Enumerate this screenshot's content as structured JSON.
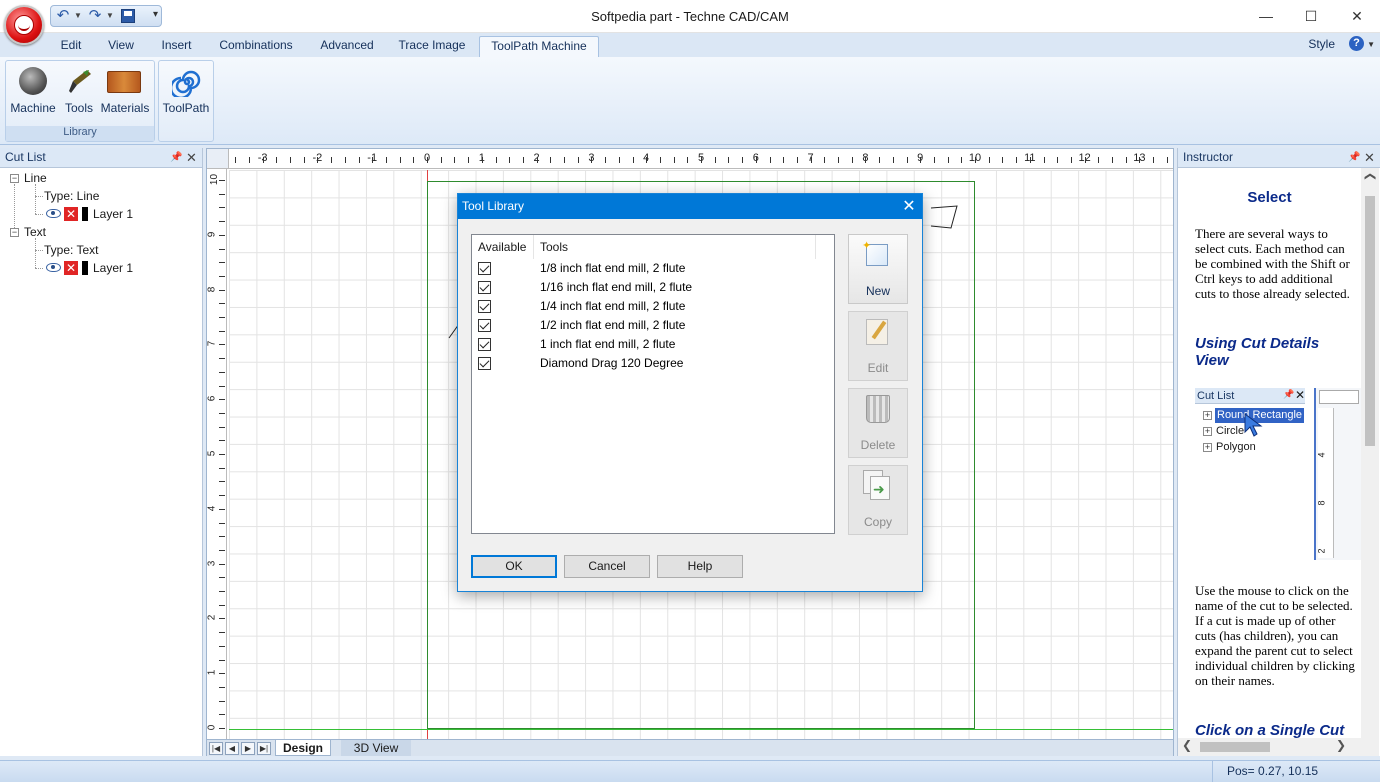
{
  "window": {
    "title": "Softpedia part - Techne CAD/CAM",
    "controls": {
      "minimize": "—",
      "maximize": "☐",
      "close": "✕"
    }
  },
  "quick_access": {
    "undo": "↶",
    "redo": "↷",
    "save": "💾",
    "customize": "▾"
  },
  "menu": {
    "tabs": [
      "Edit",
      "View",
      "Insert",
      "Combinations",
      "Advanced",
      "Trace Image",
      "ToolPath  Machine"
    ],
    "active_tab": "ToolPath  Machine",
    "style": "Style",
    "help": "?"
  },
  "ribbon": {
    "library_group": {
      "label": "Library",
      "buttons": [
        "Machine",
        "Tools",
        "Materials"
      ]
    },
    "toolpath_button": "ToolPath"
  },
  "cut_list": {
    "title": "Cut List",
    "items": [
      {
        "name": "Line",
        "type": "Type: Line",
        "layer": "Layer 1"
      },
      {
        "name": "Text",
        "type": "Type: Text",
        "layer": "Layer 1"
      }
    ]
  },
  "canvas": {
    "h_ruler_labels": [
      "-3",
      "-2",
      "-1",
      "0",
      "1",
      "2",
      "3",
      "4",
      "5",
      "6",
      "7",
      "8",
      "9",
      "10",
      "11",
      "12",
      "13"
    ],
    "v_ruler_labels": [
      "10",
      "9",
      "8",
      "7",
      "6",
      "5",
      "4",
      "3",
      "2",
      "1",
      "0"
    ],
    "sheet_tabs": [
      "Design",
      "3D View"
    ],
    "active_sheet": "Design"
  },
  "instructor": {
    "title": "Instructor",
    "heading": "Select",
    "intro": "There are several ways to select cuts. Each method can be combined with the Shift or Ctrl keys to add additional cuts to those already selected.",
    "section1": "Using Cut Details View",
    "mini_panel": {
      "title": "Cut List",
      "items": [
        "Round Rectangle",
        "Circle",
        "Polygon"
      ],
      "selected": "Round Rectangle",
      "ruler_labels": [
        "4",
        "8",
        "2"
      ]
    },
    "body": "Use the mouse to click on the name of the cut to be selected.  If a cut is made up of other cuts (has children), you can expand the parent cut to select individual children by clicking on their names.",
    "section2": "Click on a Single Cut"
  },
  "status": {
    "position": "Pos= 0.27, 10.15"
  },
  "tool_library_dialog": {
    "title": "Tool Library",
    "columns": [
      "Available",
      "Tools"
    ],
    "tools": [
      {
        "name": "1/8 inch flat end mill, 2 flute",
        "available": true
      },
      {
        "name": "1/16 inch flat end mill, 2 flute",
        "available": true
      },
      {
        "name": "1/4 inch flat end mill, 2 flute",
        "available": true
      },
      {
        "name": "1/2 inch flat end mill, 2 flute",
        "available": true
      },
      {
        "name": "1 inch flat end mill, 2 flute",
        "available": true
      },
      {
        "name": "Diamond Drag 120 Degree",
        "available": true
      }
    ],
    "side_buttons": [
      {
        "label": "New",
        "enabled": true
      },
      {
        "label": "Edit",
        "enabled": false
      },
      {
        "label": "Delete",
        "enabled": false
      },
      {
        "label": "Copy",
        "enabled": false
      }
    ],
    "buttons": {
      "ok": "OK",
      "cancel": "Cancel",
      "help": "Help"
    }
  },
  "colors": {
    "accent": "#0078d7",
    "ribbon": "#dde9f7",
    "heading_blue": "#0b2a8a"
  }
}
